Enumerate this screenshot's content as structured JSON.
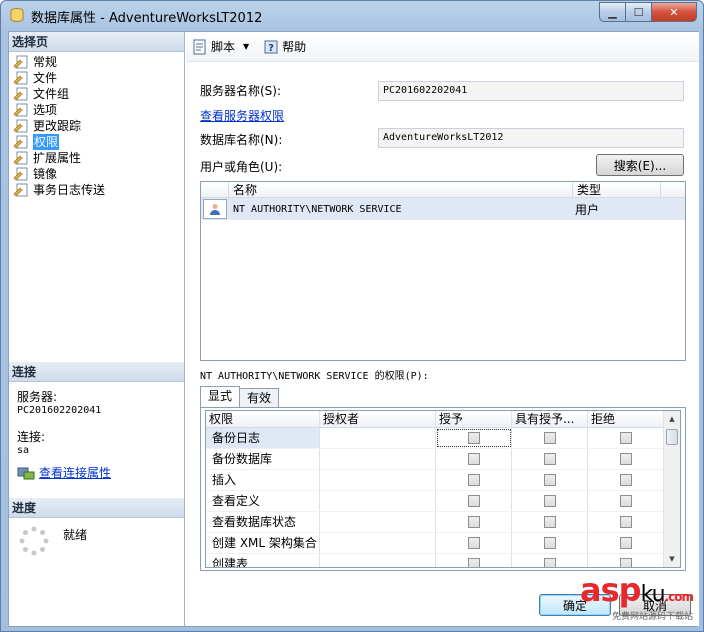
{
  "window": {
    "title": "数据库属性 - AdventureWorksLT2012"
  },
  "left": {
    "select_page_header": "选择页",
    "nav_items": [
      {
        "label": "常规",
        "icon": "page-icon"
      },
      {
        "label": "文件",
        "icon": "page-icon"
      },
      {
        "label": "文件组",
        "icon": "page-icon"
      },
      {
        "label": "选项",
        "icon": "page-icon"
      },
      {
        "label": "更改跟踪",
        "icon": "page-icon"
      },
      {
        "label": "权限",
        "icon": "page-icon",
        "selected": true
      },
      {
        "label": "扩展属性",
        "icon": "page-icon"
      },
      {
        "label": "镜像",
        "icon": "page-icon"
      },
      {
        "label": "事务日志传送",
        "icon": "page-icon"
      }
    ],
    "connection": {
      "header": "连接",
      "server_label": "服务器:",
      "server_value": "PC201602202041",
      "connection_label": "连接:",
      "connection_value": "sa",
      "view_link": "查看连接属性"
    },
    "progress": {
      "header": "进度",
      "status": "就绪"
    }
  },
  "toolbar": {
    "script_label": "脚本",
    "help_label": "帮助"
  },
  "form": {
    "server_name_label": "服务器名称(S):",
    "server_name_value": "PC201602202041",
    "view_server_permissions_link": "查看服务器权限",
    "db_name_label": "数据库名称(N):",
    "db_name_value": "AdventureWorksLT2012",
    "users_roles_label": "用户或角色(U):",
    "search_button": "搜索(E)..."
  },
  "users_grid": {
    "columns": [
      "名称",
      "类型"
    ],
    "rows": [
      {
        "name": "NT AUTHORITY\\NETWORK SERVICE",
        "type": "用户"
      }
    ]
  },
  "permissions": {
    "label": "NT AUTHORITY\\NETWORK SERVICE 的权限(P):",
    "tabs": [
      "显式",
      "有效"
    ],
    "columns": [
      "权限",
      "授权者",
      "授予",
      "具有授予...",
      "拒绝"
    ],
    "rows": [
      "备份日志",
      "备份数据库",
      "插入",
      "查看定义",
      "查看数据库状态",
      "创建 XML 架构集合",
      "创建表"
    ]
  },
  "buttons": {
    "ok": "确定",
    "cancel": "取消"
  },
  "watermark": {
    "brand_a": "asp",
    "brand_b": "ku",
    "dot": ".com",
    "sub": "免费网站源码下载站"
  }
}
